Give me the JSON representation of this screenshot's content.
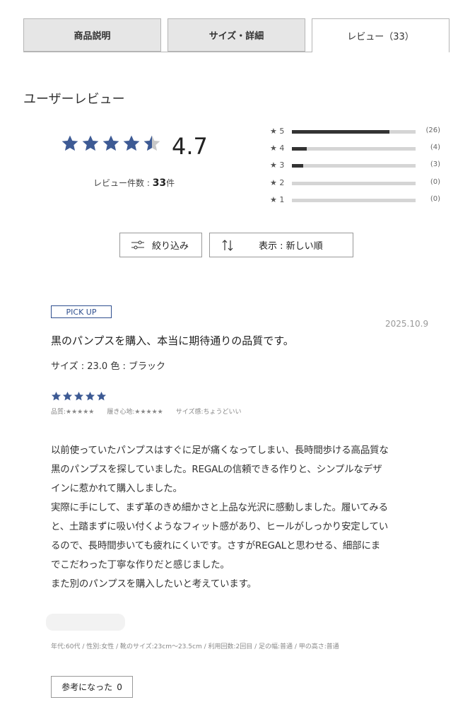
{
  "tabs": [
    {
      "label": "商品説明"
    },
    {
      "label": "サイズ・詳細"
    },
    {
      "label": "レビュー（33）"
    }
  ],
  "section_title": "ユーザーレビュー",
  "summary": {
    "average": "4.7",
    "rating_fraction": 0.94,
    "count_label": "レビュー件数 : ",
    "count_value": "33",
    "count_unit": "件"
  },
  "histogram": [
    {
      "label": "★ 5",
      "count": "(26)",
      "ratio": 0.79
    },
    {
      "label": "★ 4",
      "count": "(4)",
      "ratio": 0.12
    },
    {
      "label": "★ 3",
      "count": "(3)",
      "ratio": 0.09
    },
    {
      "label": "★ 2",
      "count": "(0)",
      "ratio": 0
    },
    {
      "label": "★ 1",
      "count": "(0)",
      "ratio": 0
    }
  ],
  "controls": {
    "filter_label": "絞り込み",
    "sort_label": "表示 : 新しい順"
  },
  "review": {
    "badge": "PICK UP",
    "date": "2025.10.9",
    "title": "黒のパンプスを購入、本当に期待通りの品質です。",
    "size_color": "サイズ : 23.0 色 : ブラック",
    "rating": 5,
    "sub_ratings": [
      "品質:★★★★★",
      "履き心地:★★★★★",
      "サイズ感:ちょうどいい"
    ],
    "body_lines": [
      "以前使っていたパンプスはすぐに足が痛くなってしまい、長時間歩ける高品質な",
      "黒のパンプスを探していました。REGALの信頼できる作りと、シンプルなデザ",
      "インに惹かれて購入しました。",
      "実際に手にして、まず革のきめ細かさと上品な光沢に感動しました。履いてみる",
      "と、土踏まずに吸い付くようなフィット感があり、ヒールがしっかり安定してい",
      "るので、長時間歩いても疲れにくいです。さすがREGALと思わせる、細部にま",
      "でこだわった丁寧な作りだと感じました。",
      "また別のパンプスを購入したいと考えています。"
    ],
    "meta": "年代:60代 / 性別:女性 / 靴のサイズ:23cm〜23.5cm / 利用回数:2回目 / 足の幅:普通 / 甲の高さ:普通",
    "helpful_label": "参考になった",
    "helpful_count": "0"
  },
  "colors": {
    "star_blue": "#3d5a94",
    "star_grey": "#c8c8c8",
    "bar_fill": "#333333",
    "bar_track": "#d5d5d5"
  }
}
